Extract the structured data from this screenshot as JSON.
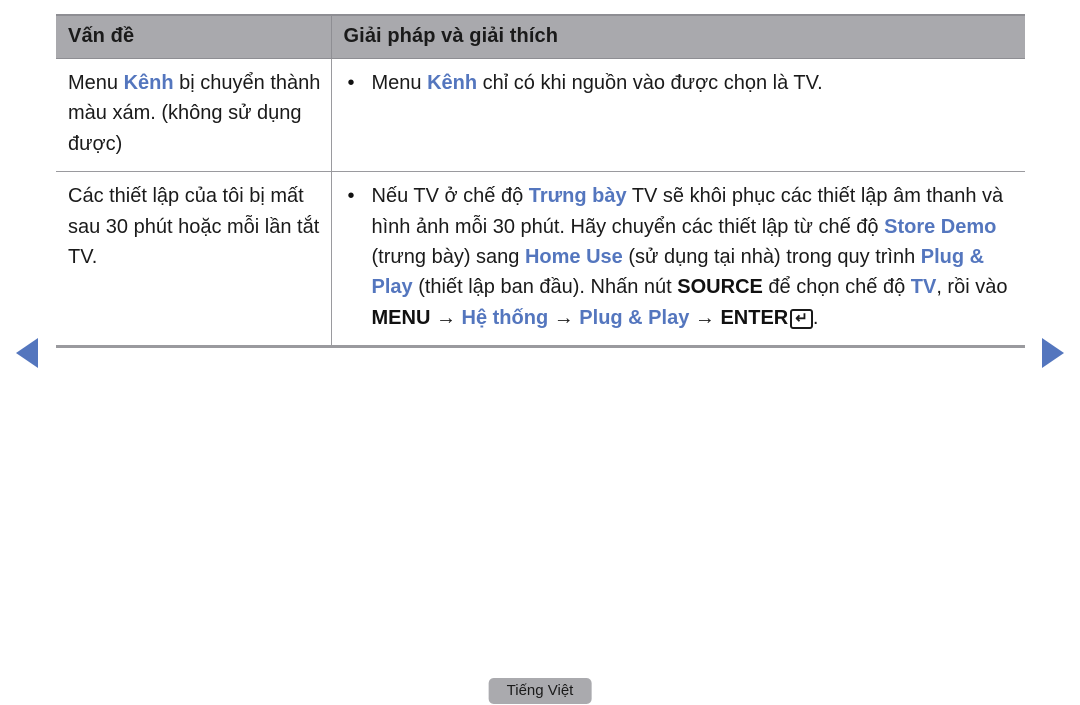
{
  "nav": {
    "prev_label": "previous page",
    "next_label": "next page",
    "arrow_color": "#5476be"
  },
  "table": {
    "headers": {
      "problem": "Vấn đề",
      "solution": "Giải pháp và giải thích"
    },
    "rows": [
      {
        "problem_lines": [
          "Menu ",
          "Kênh",
          " bị chuyển thành màu xám. (không sử dụng được)"
        ],
        "problem_plain": "Menu Kênh bị chuyển thành màu xám. (không sử dụng được)",
        "bullet": "•",
        "solution_plain": "Menu Kênh chỉ có khi nguồn vào được chọn là TV.",
        "solution_segments": [
          {
            "text": "Menu ",
            "style": "plain"
          },
          {
            "text": "Kênh",
            "style": "blue-bold"
          },
          {
            "text": " chỉ có khi nguồn vào được chọn là TV.",
            "style": "plain"
          }
        ]
      },
      {
        "problem_plain": "Các thiết lập của tôi bị mất sau 30 phút hoặc mỗi lần tắt TV.",
        "bullet": "•",
        "solution_plain": "Nếu TV ở chế độ Trưng bày TV sẽ khôi phục các thiết lập âm thanh và hình ảnh mỗi 30 phút. Hãy chuyển các thiết lập từ chế độ Store Demo (trưng bày) sang Home Use (sử dụng tại nhà) trong quy trình Plug & Play (thiết lập ban đầu). Nhấn nút SOURCE để chọn chế độ TV, rồi vào MENU → Hệ thống → Plug & Play → ENTER.",
        "solution_segments": [
          {
            "text": "Nếu TV ở chế độ ",
            "style": "plain"
          },
          {
            "text": "Trưng bày",
            "style": "blue-bold"
          },
          {
            "text": " TV sẽ khôi phục các thiết lập âm thanh và hình ảnh mỗi 30 phút. Hãy chuyển các thiết lập từ chế độ ",
            "style": "plain"
          },
          {
            "text": "Store Demo",
            "style": "blue-bold"
          },
          {
            "text": " (trưng bày) sang ",
            "style": "plain"
          },
          {
            "text": "Home Use",
            "style": "blue-bold"
          },
          {
            "text": " (sử dụng tại nhà) trong quy trình ",
            "style": "plain"
          },
          {
            "text": "Plug & Play",
            "style": "blue-bold"
          },
          {
            "text": " (thiết lập ban đầu). Nhấn nút ",
            "style": "plain"
          },
          {
            "text": "SOURCE",
            "style": "black-bold"
          },
          {
            "text": " để chọn chế độ ",
            "style": "plain"
          },
          {
            "text": "TV",
            "style": "blue-bold"
          },
          {
            "text": ", rồi vào ",
            "style": "plain"
          },
          {
            "text": "MENU",
            "style": "black-bold"
          },
          {
            "text": " → ",
            "style": "plain"
          },
          {
            "text": "Hệ thống",
            "style": "blue-bold"
          },
          {
            "text": " → ",
            "style": "plain"
          },
          {
            "text": "Plug & Play",
            "style": "blue-bold"
          },
          {
            "text": " → ",
            "style": "plain"
          },
          {
            "text": "ENTER",
            "style": "black-bold"
          },
          {
            "text": "enter-key-glyph",
            "style": "key"
          },
          {
            "text": ".",
            "style": "plain"
          }
        ]
      }
    ]
  },
  "inline_text": {
    "r1_sol_a": "Menu ",
    "r1_sol_kenh": "Kênh",
    "r1_sol_b": " chỉ có khi nguồn vào được chọn là TV.",
    "r1_prob_a": "Menu ",
    "r1_prob_kenh": "Kênh",
    "r1_prob_b": " bị chuyển thành màu xám. (không sử dụng được)",
    "r2_prob": "Các thiết lập của tôi bị mất sau 30 phút hoặc mỗi lần tắt TV.",
    "r2_s1": "Nếu TV ở chế độ ",
    "r2_s2": "Trưng bày",
    "r2_s3": " TV sẽ khôi phục các thiết lập âm thanh và hình ảnh mỗi 30 phút. Hãy chuyển các thiết lập từ chế độ ",
    "r2_s4": "Store Demo",
    "r2_s5": " (trưng bày) sang ",
    "r2_s6": "Home Use",
    "r2_s7": " (sử dụng tại nhà) trong quy trình ",
    "r2_s8": "Plug & Play",
    "r2_s9": " (thiết lập ban đầu). Nhấn nút ",
    "r2_s10": "SOURCE",
    "r2_s11": " để chọn chế độ ",
    "r2_s12": "TV",
    "r2_s13": ", rồi vào ",
    "r2_s14": "MENU",
    "r2_s15": " → ",
    "r2_s16": "Hệ thống",
    "r2_s17": " → ",
    "r2_s18": "Plug & Play",
    "r2_s19": " → ",
    "r2_s20": "ENTER",
    "r2_enter_glyph": "↵",
    "r2_s21": ".",
    "bullet": "•"
  },
  "footer": {
    "language_label": "Tiếng Việt"
  },
  "colors": {
    "accent_blue": "#5476be",
    "header_gray": "#a9a9ad",
    "badge_gray": "#aaaaae",
    "text_black": "#1a1a1a"
  }
}
